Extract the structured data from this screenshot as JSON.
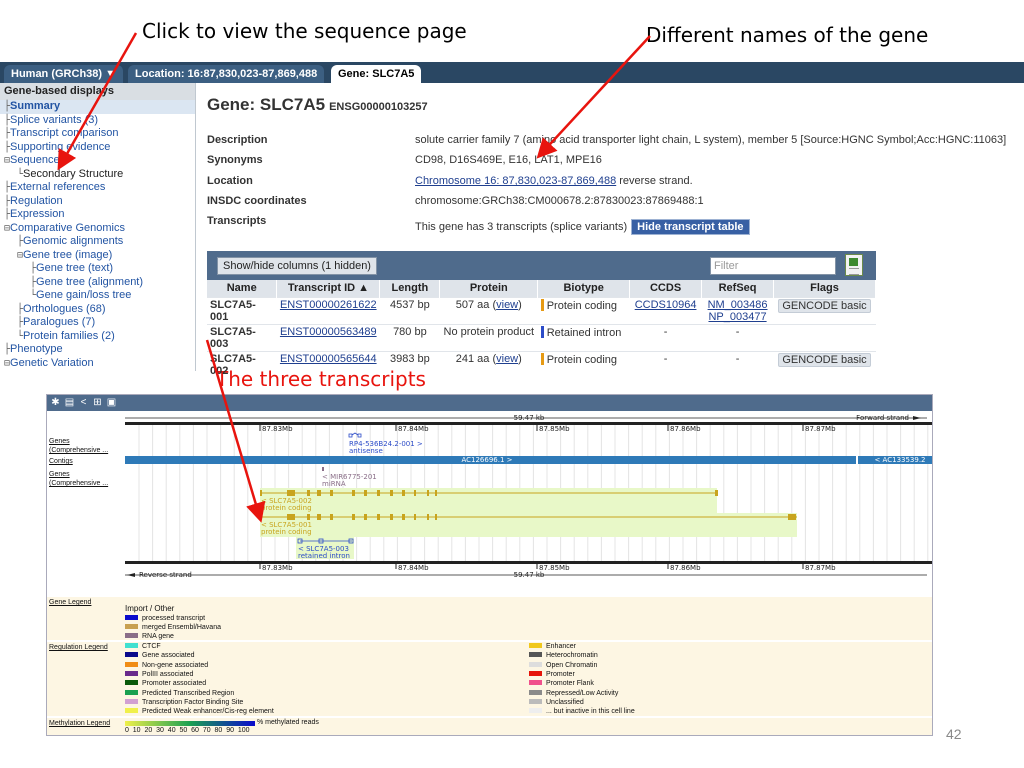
{
  "annotations": {
    "sequence_page": "Click to view the sequence page",
    "gene_names": "Different names of the gene",
    "three_transcripts": "The three transcripts"
  },
  "tabs": [
    {
      "label": "Human (GRCh38) ▼"
    },
    {
      "label": "Location: 16:87,830,023-87,869,488"
    },
    {
      "label": "Gene: SLC7A5"
    }
  ],
  "sidebar": {
    "title": "Gene-based displays",
    "items": [
      {
        "label": "Summary",
        "prefix": "├",
        "indent": 0
      },
      {
        "label": "Splice variants (3)",
        "prefix": "├",
        "indent": 0
      },
      {
        "label": "Transcript comparison",
        "prefix": "├",
        "indent": 0
      },
      {
        "label": "Supporting evidence",
        "prefix": "├",
        "indent": 0
      },
      {
        "label": "Sequence",
        "prefix": "⊟",
        "indent": 0
      },
      {
        "label": "Secondary Structure",
        "prefix": "└",
        "indent": 1
      },
      {
        "label": "External references",
        "prefix": "├",
        "indent": 0
      },
      {
        "label": "Regulation",
        "prefix": "├",
        "indent": 0
      },
      {
        "label": "Expression",
        "prefix": "├",
        "indent": 0
      },
      {
        "label": "Comparative Genomics",
        "prefix": "⊟",
        "indent": 0
      },
      {
        "label": "Genomic alignments",
        "prefix": "├",
        "indent": 1
      },
      {
        "label": "Gene tree (image)",
        "prefix": "⊟",
        "indent": 1
      },
      {
        "label": "Gene tree (text)",
        "prefix": "├",
        "indent": 2
      },
      {
        "label": "Gene tree (alignment)",
        "prefix": "├",
        "indent": 2
      },
      {
        "label": "Gene gain/loss tree",
        "prefix": "└",
        "indent": 2
      },
      {
        "label": "Orthologues (68)",
        "prefix": "├",
        "indent": 1
      },
      {
        "label": "Paralogues (7)",
        "prefix": "├",
        "indent": 1
      },
      {
        "label": "Protein families (2)",
        "prefix": "└",
        "indent": 1
      },
      {
        "label": "Phenotype",
        "prefix": "├",
        "indent": 0
      },
      {
        "label": "Genetic Variation",
        "prefix": "⊟",
        "indent": 0
      }
    ]
  },
  "gene": {
    "title": "Gene: SLC7A5",
    "ensg": "ENSG00000103257",
    "summary": [
      {
        "key": "Description",
        "value": "solute carrier family 7 (amino acid transporter light chain, L system), member 5 [Source:HGNC Symbol;Acc:HGNC:11063]"
      },
      {
        "key": "Synonyms",
        "value": "CD98, D16S469E, E16, LAT1, MPE16"
      },
      {
        "key": "Location",
        "link": "Chromosome 16: 87,830,023-87,869,488",
        "suffix": " reverse strand."
      },
      {
        "key": "INSDC coordinates",
        "value": "chromosome:GRCh38:CM000678.2:87830023:87869488:1"
      },
      {
        "key": "Transcripts",
        "value": "This gene has 3 transcripts (splice variants)",
        "button": "Hide transcript table"
      }
    ]
  },
  "transcript_table": {
    "showhide_label": "Show/hide columns (1 hidden)",
    "filter_placeholder": "Filter",
    "headers": [
      "Name",
      "Transcript ID ▲",
      "Length",
      "Protein",
      "Biotype",
      "CCDS",
      "RefSeq",
      "Flags"
    ],
    "rows": [
      {
        "name": "SLC7A5-001",
        "id": "ENST00000261622",
        "length": "4537 bp",
        "protein_pre": "507 aa (",
        "protein_link": "view",
        "protein_post": ")",
        "biotype": "Protein coding",
        "biotype_color": "#e69a14",
        "ccds": "CCDS10964",
        "refseq1": "NM_003486",
        "refseq2": "NP_003477",
        "flags": "GENCODE basic"
      },
      {
        "name": "SLC7A5-003",
        "id": "ENST00000563489",
        "length": "780 bp",
        "protein_pre": "No protein product",
        "protein_link": "",
        "protein_post": "",
        "biotype": "Retained intron",
        "biotype_color": "#2c4cc8",
        "ccds": "-",
        "refseq1": "-",
        "refseq2": "",
        "flags": ""
      },
      {
        "name": "SLC7A5-002",
        "id": "ENST00000565644",
        "length": "3983 bp",
        "protein_pre": "241 aa (",
        "protein_link": "view",
        "protein_post": ")",
        "biotype": "Protein coding",
        "biotype_color": "#e69a14",
        "ccds": "-",
        "refseq1": "-",
        "refseq2": "",
        "flags": "GENCODE basic"
      }
    ]
  },
  "browser": {
    "scale_label": "59.47 kb",
    "forward_strand": "Forward strand",
    "reverse_strand": "Reverse strand",
    "ticks": [
      "87.83Mb",
      "87.84Mb",
      "87.85Mb",
      "87.86Mb",
      "87.87Mb"
    ],
    "track_labels": {
      "genes_top": "Genes\n(Comprehensive ...",
      "contigs": "Contigs",
      "genes_bottom": "Genes\n(Comprehensive ..."
    },
    "contig_left": "AC126696.1 >",
    "contig_right": "< AC133539.2",
    "antisense_name": "RP4-536B24.2-001 >",
    "antisense_type": "antisense",
    "mirna_name": "< MIR6775-201",
    "mirna_type": "miRNA",
    "t002_name": "< SLC7A5-002",
    "t002_type": "protein coding",
    "t001_name": "< SLC7A5-001",
    "t001_type": "protein coding",
    "t003_name": "< SLC7A5-003",
    "t003_type": "retained intron",
    "gene_color": "#c8a41e",
    "utr_color": "#e8f8c8"
  },
  "gene_legend": {
    "title": "Gene Legend",
    "subtitle": "Import / Other",
    "items": [
      {
        "label": "processed transcript",
        "color": "#0a0acc"
      },
      {
        "label": "merged Ensembl/Havana",
        "color": "#c8a050"
      },
      {
        "label": "RNA gene",
        "color": "#8a6e88"
      }
    ]
  },
  "regulation_legend": {
    "title": "Regulation Legend",
    "left": [
      {
        "label": "CTCF",
        "color": "#40e0d0"
      },
      {
        "label": "Gene associated",
        "color": "#0a0a8c"
      },
      {
        "label": "Non-gene associated",
        "color": "#f08c14"
      },
      {
        "label": "PolIII associated",
        "color": "#6a2a8c"
      },
      {
        "label": "Promoter associated",
        "color": "#0a5a0a"
      },
      {
        "label": "Predicted Transcribed Region",
        "color": "#1aa050"
      },
      {
        "label": "Transcription Factor Binding Site",
        "color": "#d2a0d2"
      },
      {
        "label": "Predicted Weak enhancer/Cis-reg element",
        "color": "#f0f04a"
      }
    ],
    "right": [
      {
        "label": "Enhancer",
        "color": "#f0c81e"
      },
      {
        "label": "Heterochromatin",
        "color": "#555555"
      },
      {
        "label": "Open Chromatin",
        "color": "#dddddd"
      },
      {
        "label": "Promoter",
        "color": "#e6140a"
      },
      {
        "label": "Promoter Flank",
        "color": "#f0508c"
      },
      {
        "label": "Repressed/Low Activity",
        "color": "#8a8a8a"
      },
      {
        "label": "Unclassified",
        "color": "#bbbbbb"
      },
      {
        "label": "... but inactive in this cell line",
        "color": "#eeeeee"
      }
    ]
  },
  "methylation_legend": {
    "title": "Methylation Legend",
    "label": "% methylated reads",
    "scale": "0  10  20  30  40  50  60  70  80  90  100"
  },
  "slide_number": "42"
}
